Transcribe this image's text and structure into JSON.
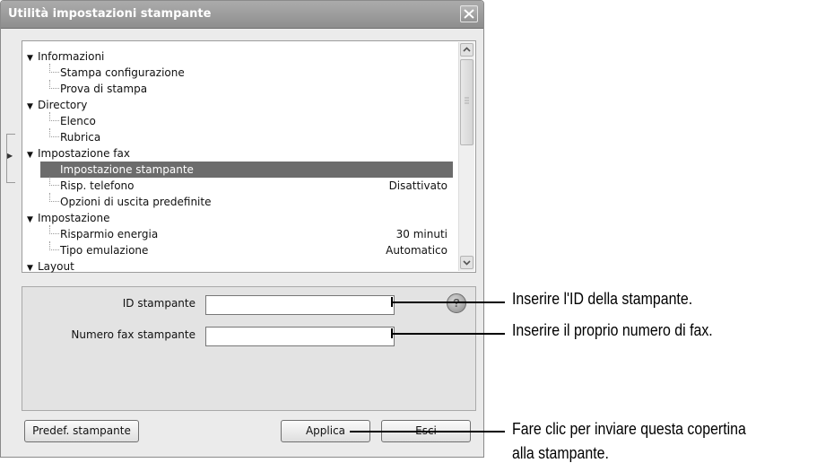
{
  "window": {
    "title": "Utilità impostazioni stampante",
    "close_icon": "close-x-icon"
  },
  "tree": {
    "items": [
      {
        "level": 0,
        "label": "Informazioni",
        "value": ""
      },
      {
        "level": 1,
        "label": "Stampa configurazione",
        "value": ""
      },
      {
        "level": 1,
        "label": "Prova di stampa",
        "value": ""
      },
      {
        "level": 0,
        "label": "Directory",
        "value": ""
      },
      {
        "level": 1,
        "label": "Elenco",
        "value": ""
      },
      {
        "level": 1,
        "label": "Rubrica",
        "value": ""
      },
      {
        "level": 0,
        "label": "Impostazione fax",
        "value": ""
      },
      {
        "level": 1,
        "label": "Impostazione stampante",
        "value": "",
        "selected": true
      },
      {
        "level": 1,
        "label": "Risp. telefono",
        "value": "Disattivato"
      },
      {
        "level": 1,
        "label": "Opzioni di uscita predefinite",
        "value": ""
      },
      {
        "level": 0,
        "label": "Impostazione",
        "value": ""
      },
      {
        "level": 1,
        "label": "Risparmio energia",
        "value": "30 minuti"
      },
      {
        "level": 1,
        "label": "Tipo emulazione",
        "value": "Automatico"
      },
      {
        "level": 0,
        "label": "Layout",
        "value": ""
      }
    ]
  },
  "settings": {
    "printer_id_label": "ID stampante",
    "printer_id_value": "",
    "fax_number_label": "Numero fax stampante",
    "fax_number_value": "",
    "help_icon": "help-icon",
    "help_glyph": "?"
  },
  "buttons": {
    "defaults": "Predef. stampante",
    "apply": "Applica",
    "exit": "Esci"
  },
  "callouts": {
    "printer_id": "Inserire l'ID della stampante.",
    "fax_number": "Inserire il proprio numero di fax.",
    "apply_line1": "Fare clic per inviare questa copertina",
    "apply_line2": "alla  stampante."
  },
  "colors": {
    "titlebar": "#9b9b9b",
    "selected_row": "#6c6c6c",
    "window_bg": "#ebebeb"
  }
}
